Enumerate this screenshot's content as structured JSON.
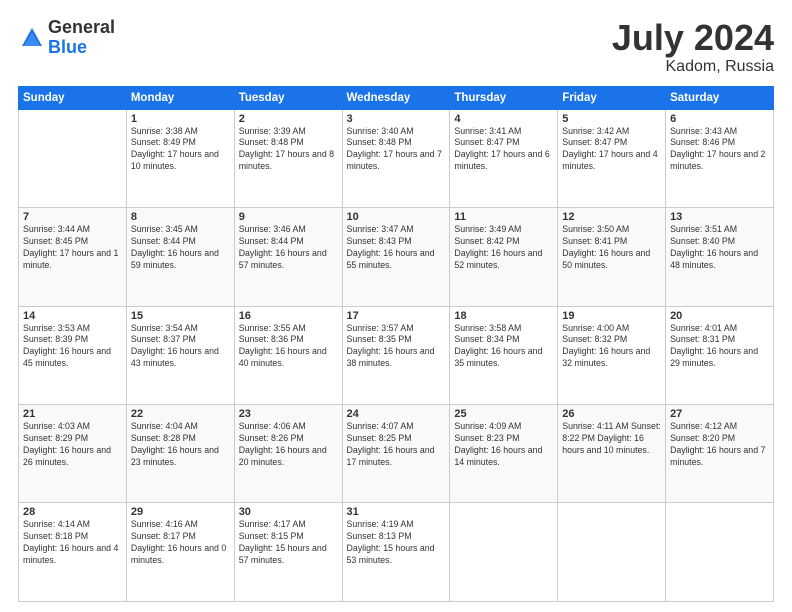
{
  "logo": {
    "general": "General",
    "blue": "Blue"
  },
  "title": "July 2024",
  "location": "Kadom, Russia",
  "header_days": [
    "Sunday",
    "Monday",
    "Tuesday",
    "Wednesday",
    "Thursday",
    "Friday",
    "Saturday"
  ],
  "weeks": [
    [
      {
        "day": "",
        "content": ""
      },
      {
        "day": "1",
        "content": "Sunrise: 3:38 AM\nSunset: 8:49 PM\nDaylight: 17 hours\nand 10 minutes."
      },
      {
        "day": "2",
        "content": "Sunrise: 3:39 AM\nSunset: 8:48 PM\nDaylight: 17 hours\nand 8 minutes."
      },
      {
        "day": "3",
        "content": "Sunrise: 3:40 AM\nSunset: 8:48 PM\nDaylight: 17 hours\nand 7 minutes."
      },
      {
        "day": "4",
        "content": "Sunrise: 3:41 AM\nSunset: 8:47 PM\nDaylight: 17 hours\nand 6 minutes."
      },
      {
        "day": "5",
        "content": "Sunrise: 3:42 AM\nSunset: 8:47 PM\nDaylight: 17 hours\nand 4 minutes."
      },
      {
        "day": "6",
        "content": "Sunrise: 3:43 AM\nSunset: 8:46 PM\nDaylight: 17 hours\nand 2 minutes."
      }
    ],
    [
      {
        "day": "7",
        "content": "Sunrise: 3:44 AM\nSunset: 8:45 PM\nDaylight: 17 hours\nand 1 minute."
      },
      {
        "day": "8",
        "content": "Sunrise: 3:45 AM\nSunset: 8:44 PM\nDaylight: 16 hours\nand 59 minutes."
      },
      {
        "day": "9",
        "content": "Sunrise: 3:46 AM\nSunset: 8:44 PM\nDaylight: 16 hours\nand 57 minutes."
      },
      {
        "day": "10",
        "content": "Sunrise: 3:47 AM\nSunset: 8:43 PM\nDaylight: 16 hours\nand 55 minutes."
      },
      {
        "day": "11",
        "content": "Sunrise: 3:49 AM\nSunset: 8:42 PM\nDaylight: 16 hours\nand 52 minutes."
      },
      {
        "day": "12",
        "content": "Sunrise: 3:50 AM\nSunset: 8:41 PM\nDaylight: 16 hours\nand 50 minutes."
      },
      {
        "day": "13",
        "content": "Sunrise: 3:51 AM\nSunset: 8:40 PM\nDaylight: 16 hours\nand 48 minutes."
      }
    ],
    [
      {
        "day": "14",
        "content": "Sunrise: 3:53 AM\nSunset: 8:39 PM\nDaylight: 16 hours\nand 45 minutes."
      },
      {
        "day": "15",
        "content": "Sunrise: 3:54 AM\nSunset: 8:37 PM\nDaylight: 16 hours\nand 43 minutes."
      },
      {
        "day": "16",
        "content": "Sunrise: 3:55 AM\nSunset: 8:36 PM\nDaylight: 16 hours\nand 40 minutes."
      },
      {
        "day": "17",
        "content": "Sunrise: 3:57 AM\nSunset: 8:35 PM\nDaylight: 16 hours\nand 38 minutes."
      },
      {
        "day": "18",
        "content": "Sunrise: 3:58 AM\nSunset: 8:34 PM\nDaylight: 16 hours\nand 35 minutes."
      },
      {
        "day": "19",
        "content": "Sunrise: 4:00 AM\nSunset: 8:32 PM\nDaylight: 16 hours\nand 32 minutes."
      },
      {
        "day": "20",
        "content": "Sunrise: 4:01 AM\nSunset: 8:31 PM\nDaylight: 16 hours\nand 29 minutes."
      }
    ],
    [
      {
        "day": "21",
        "content": "Sunrise: 4:03 AM\nSunset: 8:29 PM\nDaylight: 16 hours\nand 26 minutes."
      },
      {
        "day": "22",
        "content": "Sunrise: 4:04 AM\nSunset: 8:28 PM\nDaylight: 16 hours\nand 23 minutes."
      },
      {
        "day": "23",
        "content": "Sunrise: 4:06 AM\nSunset: 8:26 PM\nDaylight: 16 hours\nand 20 minutes."
      },
      {
        "day": "24",
        "content": "Sunrise: 4:07 AM\nSunset: 8:25 PM\nDaylight: 16 hours\nand 17 minutes."
      },
      {
        "day": "25",
        "content": "Sunrise: 4:09 AM\nSunset: 8:23 PM\nDaylight: 16 hours\nand 14 minutes."
      },
      {
        "day": "26",
        "content": "Sunrise: 4:11 AM\nSunset: 8:22 PM\nDaylight: 16 hours\nand 10 minutes."
      },
      {
        "day": "27",
        "content": "Sunrise: 4:12 AM\nSunset: 8:20 PM\nDaylight: 16 hours\nand 7 minutes."
      }
    ],
    [
      {
        "day": "28",
        "content": "Sunrise: 4:14 AM\nSunset: 8:18 PM\nDaylight: 16 hours\nand 4 minutes."
      },
      {
        "day": "29",
        "content": "Sunrise: 4:16 AM\nSunset: 8:17 PM\nDaylight: 16 hours\nand 0 minutes."
      },
      {
        "day": "30",
        "content": "Sunrise: 4:17 AM\nSunset: 8:15 PM\nDaylight: 15 hours\nand 57 minutes."
      },
      {
        "day": "31",
        "content": "Sunrise: 4:19 AM\nSunset: 8:13 PM\nDaylight: 15 hours\nand 53 minutes."
      },
      {
        "day": "",
        "content": ""
      },
      {
        "day": "",
        "content": ""
      },
      {
        "day": "",
        "content": ""
      }
    ]
  ]
}
